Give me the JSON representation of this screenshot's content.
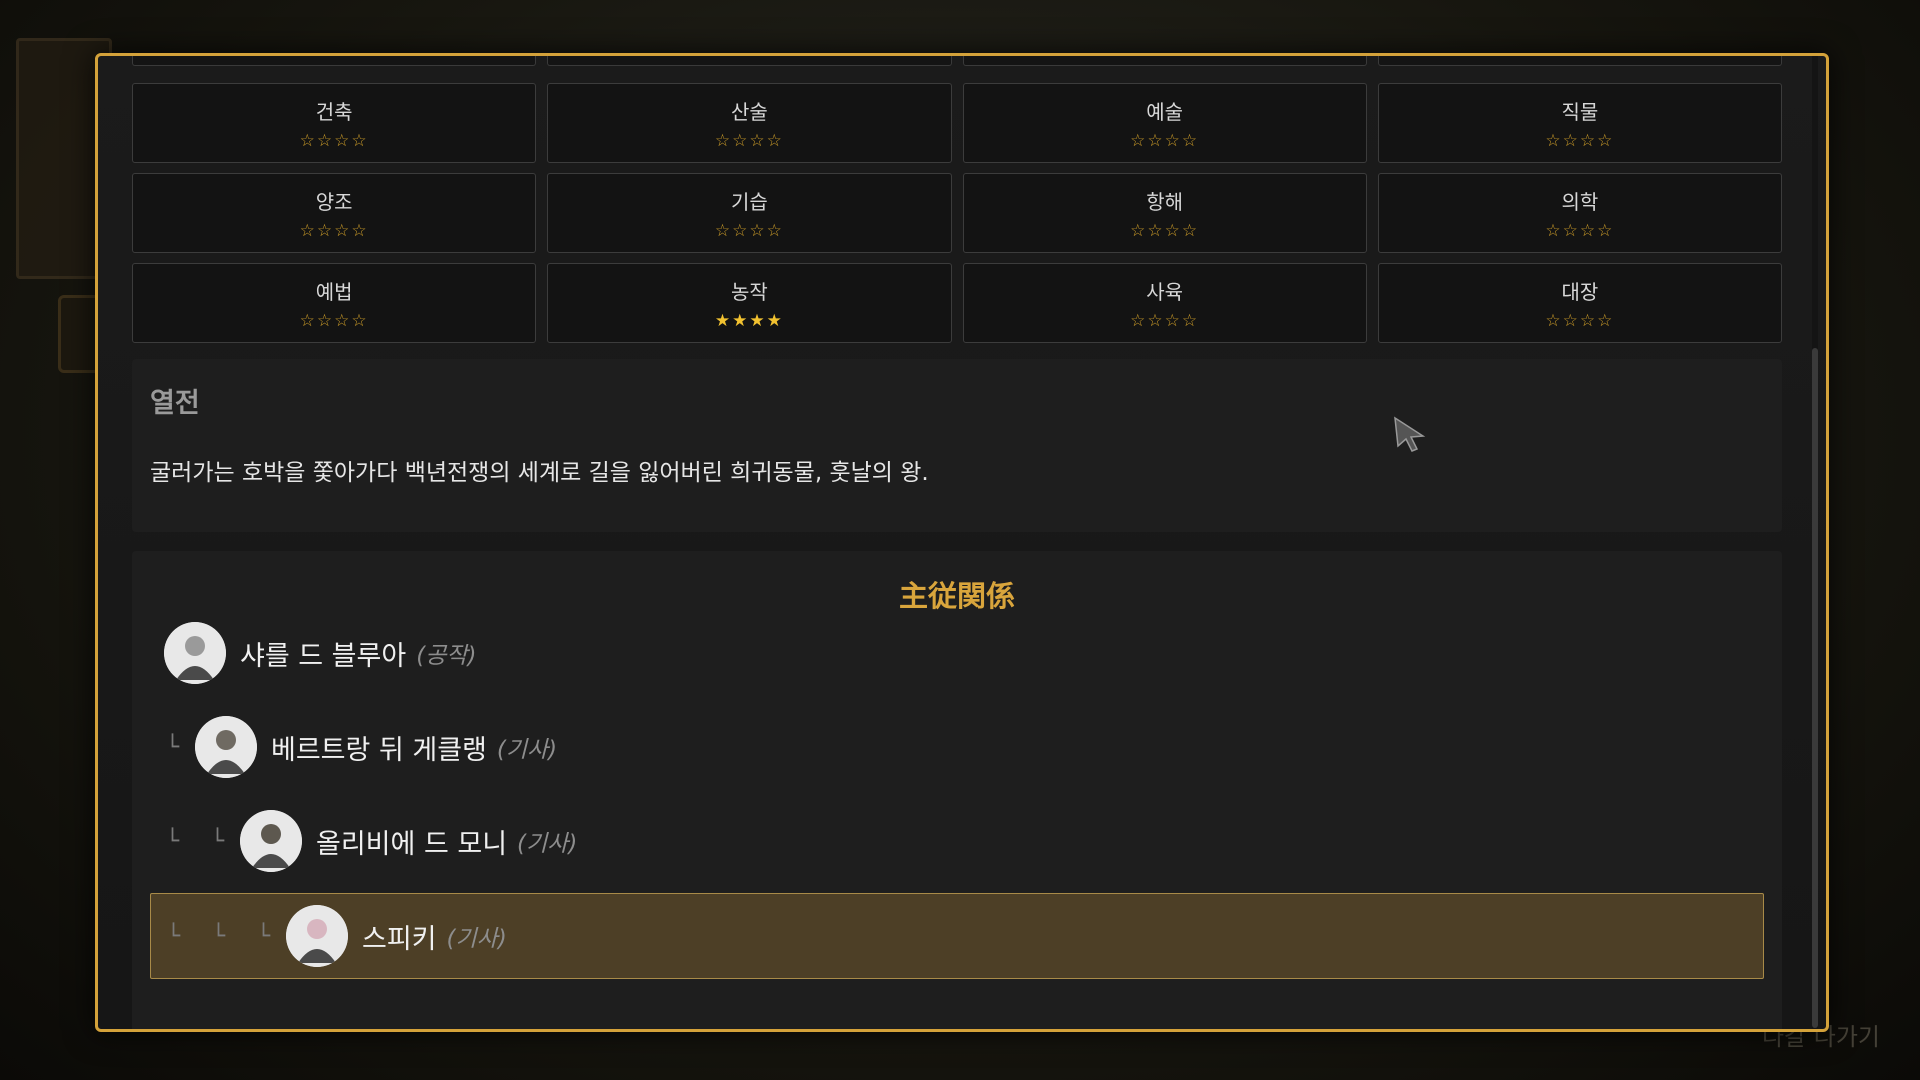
{
  "background": {
    "exit_label": "나갈 나가기"
  },
  "skills": [
    {
      "name": "건축",
      "rating": 0
    },
    {
      "name": "산술",
      "rating": 0
    },
    {
      "name": "예술",
      "rating": 0
    },
    {
      "name": "직물",
      "rating": 0
    },
    {
      "name": "양조",
      "rating": 0
    },
    {
      "name": "기습",
      "rating": 0
    },
    {
      "name": "항해",
      "rating": 0
    },
    {
      "name": "의학",
      "rating": 0
    },
    {
      "name": "예법",
      "rating": 0
    },
    {
      "name": "농작",
      "rating": 4
    },
    {
      "name": "사육",
      "rating": 0
    },
    {
      "name": "대장",
      "rating": 0
    }
  ],
  "max_rating": 4,
  "biography": {
    "title": "열전",
    "text": "굴러가는 호박을 쫓아가다 백년전쟁의 세계로 길을 잃어버린 희귀동물, 훗날의 왕."
  },
  "vassalage": {
    "title": "主従関係",
    "entries": [
      {
        "name": "샤를 드 블루아",
        "rank": "(공작)",
        "level": 0,
        "selected": false
      },
      {
        "name": "베르트랑 뒤 게클랭",
        "rank": "(기사)",
        "level": 1,
        "selected": false
      },
      {
        "name": "올리비에 드 모니",
        "rank": "(기사)",
        "level": 2,
        "selected": false
      },
      {
        "name": "스피키",
        "rank": "(기사)",
        "level": 3,
        "selected": true
      }
    ]
  },
  "colors": {
    "accent": "#d4a23a",
    "star_on": "#f2c230",
    "highlight": "#4d3f26"
  }
}
